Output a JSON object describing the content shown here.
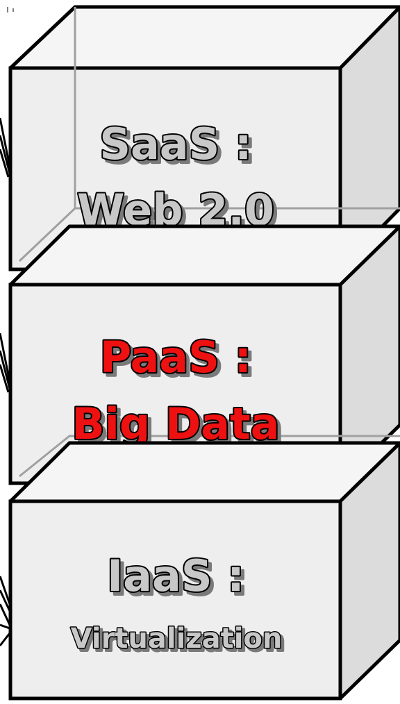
{
  "layers": [
    {
      "line1": "SaaS :",
      "line2": "Web 2.0",
      "text_color": "#c8c8c8"
    },
    {
      "line1": "PaaS :",
      "line2": "Big Data",
      "text_color": "#ee1111"
    },
    {
      "line1": "IaaS :",
      "line2": "Virtualization",
      "text_color": "#c8c8c8"
    }
  ],
  "colors": {
    "front_face": "#eeeeee",
    "top_face": "#f5f5f5",
    "side_face": "#dcdcdc",
    "outline": "#000000"
  }
}
